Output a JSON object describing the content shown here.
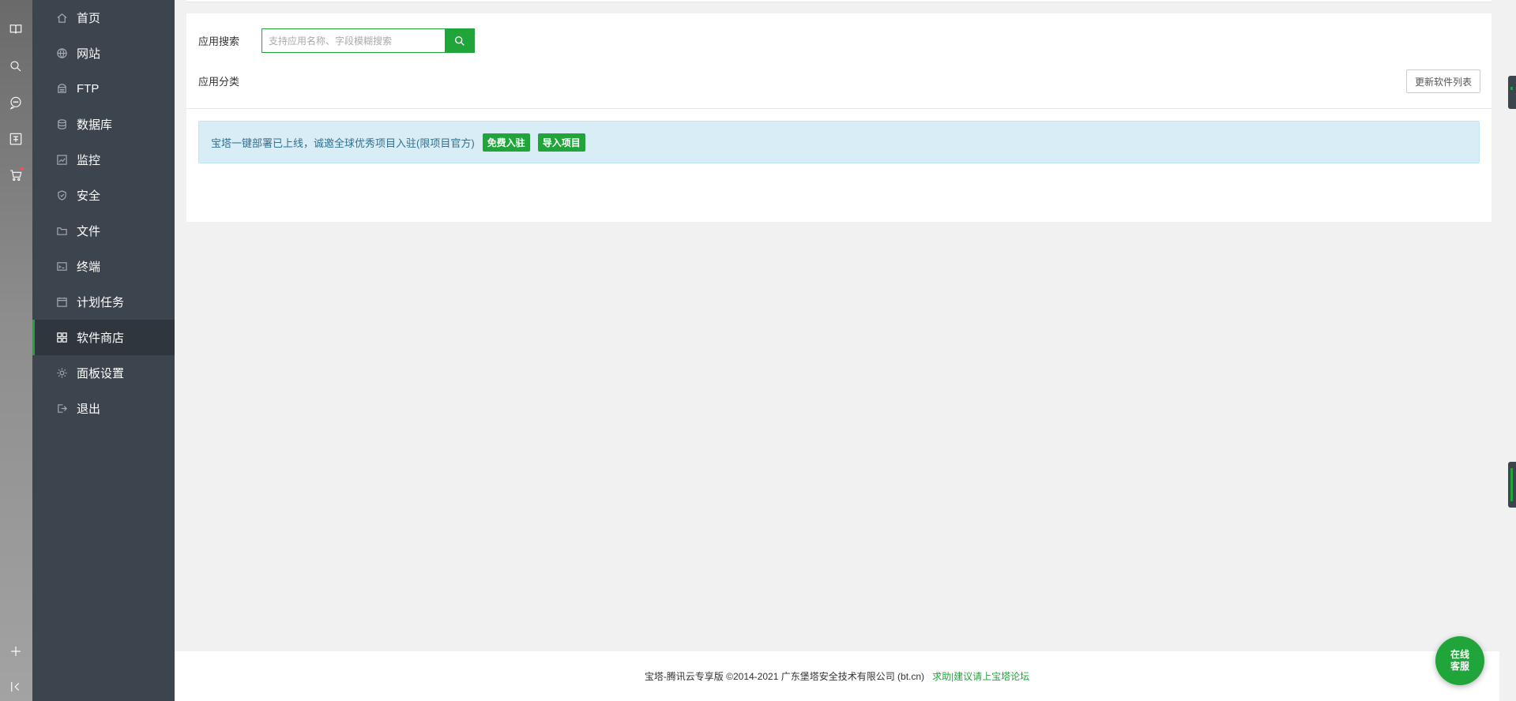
{
  "strip": {
    "icons": [
      "book-icon",
      "search-icon",
      "chat-icon",
      "translate-icon",
      "cart-icon",
      "plus-icon",
      "collapse-icon"
    ]
  },
  "sidebar": {
    "items": [
      {
        "label": "首页",
        "icon": "home-icon"
      },
      {
        "label": "网站",
        "icon": "globe-icon"
      },
      {
        "label": "FTP",
        "icon": "ftp-icon"
      },
      {
        "label": "数据库",
        "icon": "database-icon"
      },
      {
        "label": "监控",
        "icon": "monitor-icon"
      },
      {
        "label": "安全",
        "icon": "shield-icon"
      },
      {
        "label": "文件",
        "icon": "folder-icon"
      },
      {
        "label": "终端",
        "icon": "terminal-icon"
      },
      {
        "label": "计划任务",
        "icon": "calendar-icon"
      },
      {
        "label": "软件商店",
        "icon": "apps-icon",
        "active": true
      },
      {
        "label": "面板设置",
        "icon": "gear-icon"
      },
      {
        "label": "退出",
        "icon": "logout-icon"
      }
    ]
  },
  "main": {
    "search_label": "应用搜索",
    "search_placeholder": "支持应用名称、字段模糊搜索",
    "category_label": "应用分类",
    "update_button": "更新软件列表",
    "notice": {
      "text": "宝塔一键部署已上线，诚邀全球优秀项目入驻(限项目官方)",
      "tag1": "免费入驻",
      "tag2": "导入项目"
    }
  },
  "footer": {
    "copyright": "宝塔-腾讯云专享版 ©2014-2021 广东堡塔安全技术有限公司 (bt.cn)",
    "link": "求助|建议请上宝塔论坛"
  },
  "float_button": {
    "line1": "在线",
    "line2": "客服"
  },
  "colors": {
    "accent": "#20a53a",
    "sidebar_bg": "#3c444d",
    "notice_bg": "#d9edf7",
    "notice_text": "#31708f"
  }
}
